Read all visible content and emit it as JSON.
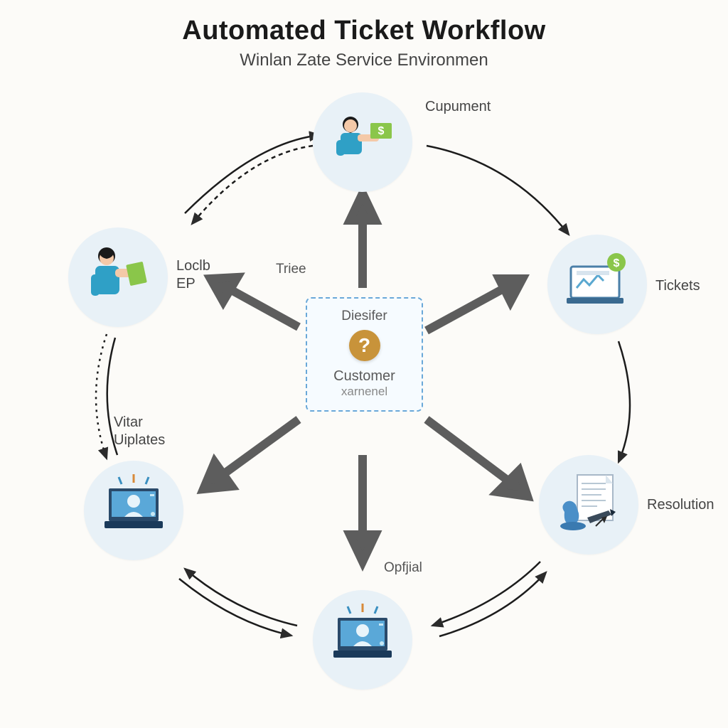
{
  "header": {
    "title": "Automated Ticket Workflow",
    "subtitle": "Winlan Zate Service Environmen"
  },
  "center": {
    "top": "Diesifer",
    "mid": "Customer",
    "bot": "xarnenel",
    "question_mark": "?"
  },
  "inner_labels": {
    "triee": "Triee",
    "opfjial": "Opfjial"
  },
  "nodes": {
    "cupument": {
      "label": "Cupument"
    },
    "tickets": {
      "label": "Tickets"
    },
    "resolution": {
      "label": "Resolution"
    },
    "bottom": {
      "label": ""
    },
    "vitar": {
      "label": "Vitar\nUiplates"
    },
    "loclb": {
      "label": "Loclb\nEP"
    }
  },
  "colors": {
    "node_bg": "#e8f1f7",
    "accent_blue": "#3f8fcf",
    "accent_teal": "#1f99a8",
    "accent_green": "#7cbf3a",
    "accent_brown": "#c8933a",
    "arrow": "#5d5d5d"
  }
}
